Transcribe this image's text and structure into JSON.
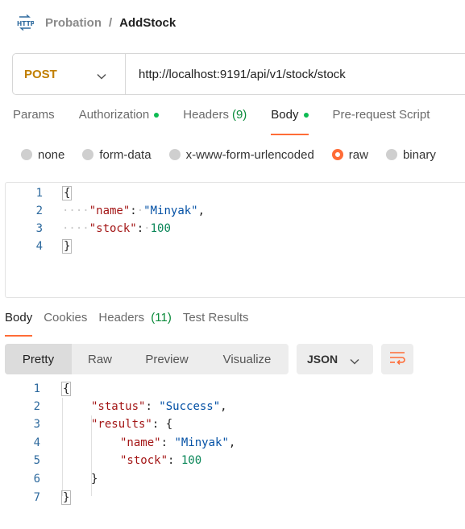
{
  "breadcrumb": {
    "parent": "Probation",
    "separator": "/",
    "current": "AddStock"
  },
  "request": {
    "method": "POST",
    "url": "http://localhost:9191/api/v1/stock/stock"
  },
  "request_tabs": [
    {
      "label": "Params"
    },
    {
      "label": "Authorization"
    },
    {
      "label": "Headers",
      "count": "(9)"
    },
    {
      "label": "Body"
    },
    {
      "label": "Pre-request Script"
    }
  ],
  "body_types": [
    "none",
    "form-data",
    "x-www-form-urlencoded",
    "raw",
    "binary"
  ],
  "body_selected": "raw",
  "request_body": {
    "line_numbers": [
      "1",
      "2",
      "3",
      "4"
    ],
    "open_brace": "{",
    "key_name": "\"name\"",
    "val_name": "\"Minyak\"",
    "key_stock": "\"stock\"",
    "val_stock": "100",
    "close_brace": "}"
  },
  "response_tabs": [
    {
      "label": "Body"
    },
    {
      "label": "Cookies"
    },
    {
      "label": "Headers",
      "count": "(11)"
    },
    {
      "label": "Test Results"
    }
  ],
  "view_modes": [
    "Pretty",
    "Raw",
    "Preview",
    "Visualize"
  ],
  "view_selected": "Pretty",
  "language": "JSON",
  "response_body": {
    "line_numbers": [
      "1",
      "2",
      "3",
      "4",
      "5",
      "6",
      "7"
    ],
    "open_brace": "{",
    "key_status": "\"status\"",
    "val_status": "\"Success\"",
    "key_results": "\"results\"",
    "key_name": "\"name\"",
    "val_name": "\"Minyak\"",
    "key_stock": "\"stock\"",
    "val_stock": "100",
    "close_inner": "}",
    "close_brace": "}"
  },
  "colors": {
    "accent": "#ff6c37",
    "method_post": "#c17f00",
    "status_dot": "#0cbb52"
  }
}
